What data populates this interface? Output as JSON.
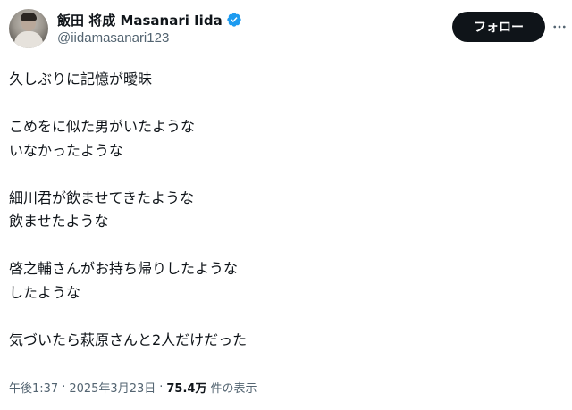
{
  "author": {
    "display_name": "飯田 将成 Masanari Iida",
    "handle": "@iidamasanari123",
    "verified_color": "#1d9bf0"
  },
  "actions": {
    "follow_label": "フォロー",
    "more_icon": "more-horizontal-icon"
  },
  "tweet": {
    "lines": [
      "久しぶりに記憶が曖昧",
      "",
      "こめをに似た男がいたような",
      "いなかったような",
      "",
      "細川君が飲ませてきたような",
      "飲ませたような",
      "",
      "啓之輔さんがお持ち帰りしたような",
      "したような",
      "",
      "気づいたら萩原さんと2人だけだった"
    ]
  },
  "meta": {
    "time": "午後1:37",
    "separator": "·",
    "date": "2025年3月23日",
    "views_count": "75.4万",
    "views_label": "件の表示"
  },
  "colors": {
    "text_primary": "#0f1419",
    "text_secondary": "#536471",
    "follow_bg": "#0f1419",
    "follow_text": "#ffffff"
  }
}
